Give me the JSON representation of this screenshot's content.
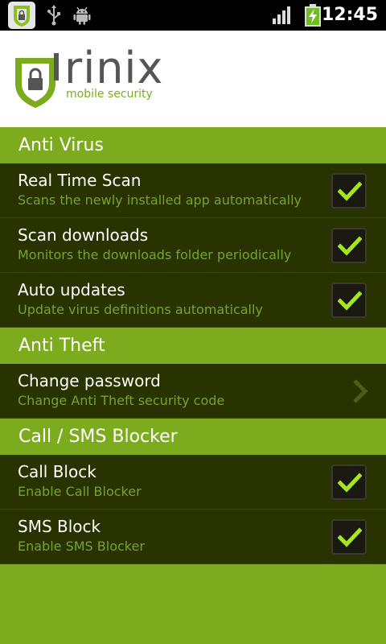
{
  "status_bar": {
    "time": "12:45",
    "icons": [
      "app-shield-icon",
      "usb-icon",
      "android-debug-icon",
      "signal-icon",
      "battery-charging-icon"
    ]
  },
  "header": {
    "brand": "rinix",
    "tagline": "mobile security"
  },
  "colors": {
    "accent": "#7cac1e",
    "row_bg": "#283300",
    "check": "#a6e61e"
  },
  "sections": [
    {
      "title": "Anti Virus",
      "items": [
        {
          "title": "Real Time Scan",
          "summary": "Scans the newly installed app automatically",
          "checked": true
        },
        {
          "title": "Scan downloads",
          "summary": "Monitors the downloads folder periodically",
          "checked": true
        },
        {
          "title": "Auto updates",
          "summary": "Update virus definitions automatically",
          "checked": true
        }
      ]
    },
    {
      "title": "Anti Theft",
      "items": [
        {
          "title": "Change password",
          "summary": "Change Anti Theft security code"
        }
      ]
    },
    {
      "title": "Call / SMS Blocker",
      "items": [
        {
          "title": "Call Block",
          "summary": "Enable Call Blocker",
          "checked": true
        },
        {
          "title": "SMS Block",
          "summary": "Enable SMS Blocker",
          "checked": true
        }
      ]
    }
  ]
}
